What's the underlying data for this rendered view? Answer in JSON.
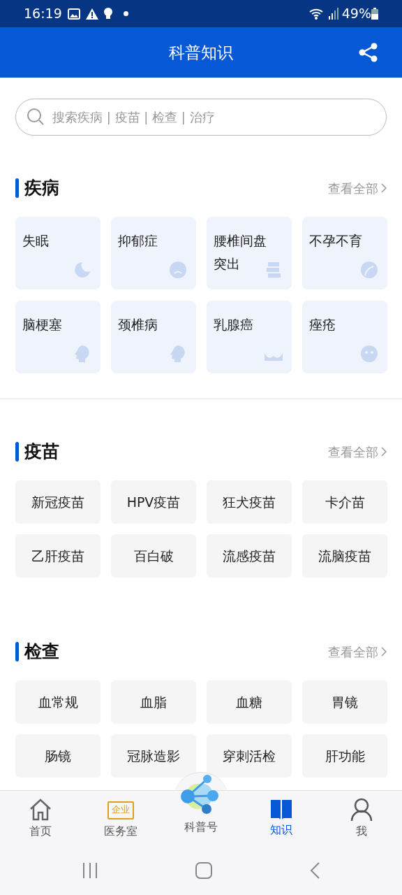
{
  "status_bar": {
    "time": "16:19",
    "battery": "49%"
  },
  "header": {
    "title": "科普知识"
  },
  "search": {
    "placeholder": "搜索疾病 | 疫苗 | 检查 | 治疗"
  },
  "sections": [
    {
      "kind": "cards",
      "title": "疾病",
      "more": "查看全部",
      "items": [
        "失眠",
        "抑郁症",
        "腰椎间盘突出",
        "不孕不育",
        "脑梗塞",
        "颈椎病",
        "乳腺癌",
        "痤疮"
      ]
    },
    {
      "kind": "chips",
      "title": "疫苗",
      "more": "查看全部",
      "items": [
        "新冠疫苗",
        "HPV疫苗",
        "狂犬疫苗",
        "卡介苗",
        "乙肝疫苗",
        "百白破",
        "流感疫苗",
        "流脑疫苗"
      ]
    },
    {
      "kind": "chips",
      "title": "检查",
      "more": "查看全部",
      "items": [
        "血常规",
        "血脂",
        "血糖",
        "胃镜",
        "肠镜",
        "冠脉造影",
        "穿刺活检",
        "肝功能"
      ]
    }
  ],
  "tab_bar": [
    {
      "kind": "home",
      "label": "首页",
      "selected": false
    },
    {
      "kind": "badge",
      "badge": "企业",
      "label": "医务室",
      "selected": false
    },
    {
      "kind": "logo",
      "label": "科普号",
      "selected": false
    },
    {
      "kind": "book",
      "label": "知识",
      "selected": true
    },
    {
      "kind": "person",
      "label": "我",
      "selected": false
    }
  ]
}
